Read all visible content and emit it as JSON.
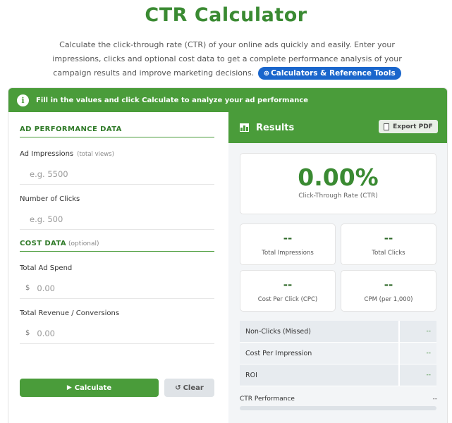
{
  "page": {
    "title": "CTR Calculator",
    "intro": "Calculate the click-through rate (CTR) of your online ads quickly and easily. Enter your impressions, clicks and optional cost data to get a complete performance analysis of your campaign results and improve marketing decisions.",
    "tools_button": "Calculators & Reference Tools"
  },
  "banner": {
    "text": "Fill in the values and click Calculate to analyze your ad performance"
  },
  "form": {
    "section1_title": "AD PERFORMANCE DATA",
    "impressions_label": "Ad Impressions",
    "impressions_hint": "(total views)",
    "impressions_placeholder": "e.g. 5500",
    "clicks_label": "Number of Clicks",
    "clicks_placeholder": "e.g. 500",
    "section2_title": "COST DATA",
    "section2_optional": "(optional)",
    "spend_label": "Total Ad Spend",
    "spend_currency": "$",
    "spend_placeholder": "0.00",
    "revenue_label": "Total Revenue / Conversions",
    "revenue_currency": "$",
    "revenue_placeholder": "0.00",
    "calculate_label": "Calculate",
    "clear_label": "Clear"
  },
  "results": {
    "title": "Results",
    "export_label": "Export PDF",
    "ctr_value": "0.00%",
    "ctr_label": "Click-Through Rate (CTR)",
    "stats": [
      {
        "value": "--",
        "label": "Total Impressions"
      },
      {
        "value": "--",
        "label": "Total Clicks"
      },
      {
        "value": "--",
        "label": "Cost Per Click (CPC)"
      },
      {
        "value": "--",
        "label": "CPM (per 1,000)"
      }
    ],
    "rows": [
      {
        "key": "Non-Clicks (Missed)",
        "value": "--"
      },
      {
        "key": "Cost Per Impression",
        "value": "--"
      },
      {
        "key": "ROI",
        "value": "--"
      }
    ],
    "performance_label": "CTR Performance",
    "performance_value": "--",
    "performance_fraction": 0
  },
  "colors": {
    "accent": "#4a9c3a",
    "title": "#3a8a32",
    "link_button": "#1a66cc"
  },
  "icons": [
    "info-icon",
    "chart-icon",
    "document-icon",
    "play-icon",
    "refresh-icon",
    "plus-circle-icon"
  ]
}
